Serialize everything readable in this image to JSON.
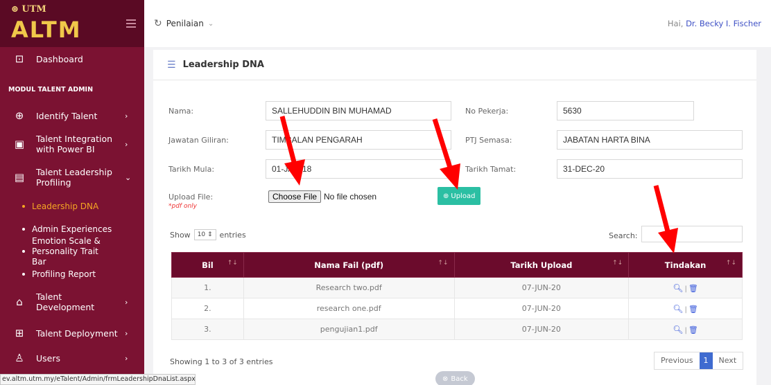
{
  "brand": {
    "utm": "UTM",
    "altm": "ALTM"
  },
  "sidebar": {
    "dashboard": "Dashboard",
    "section_title": "MODUL TALENT ADMIN",
    "items": [
      {
        "label": "Identify Talent"
      },
      {
        "label": "Talent Integration with Power BI"
      },
      {
        "label": "Talent Leadership Profiling"
      },
      {
        "label": "Talent Development"
      },
      {
        "label": "Talent Deployment"
      },
      {
        "label": "Users"
      }
    ],
    "sub_items": [
      {
        "label": "Leadership DNA"
      },
      {
        "label": "Admin Experiences"
      },
      {
        "label": "Emotion Scale & Personality Trait Bar"
      },
      {
        "label": "Profiling Report"
      }
    ]
  },
  "status_url": "ev.altm.utm.my/eTalent/Admin/frmLeadershipDnaList.aspx",
  "topbar": {
    "menu": "Penilaian",
    "greeting": "Hai,",
    "user": "Dr. Becky I. Fischer"
  },
  "card": {
    "title": "Leadership DNA"
  },
  "form": {
    "nama_label": "Nama:",
    "nama_value": "SALLEHUDDIN BIN MUHAMAD",
    "no_pekerja_label": "No Pekerja:",
    "no_pekerja_value": "5630",
    "jawatan_label": "Jawatan Giliran:",
    "jawatan_value": "TIMBALAN PENGARAH",
    "ptj_label": "PTJ Semasa:",
    "ptj_value": "JABATAN HARTA BINA",
    "tarikh_mula_label": "Tarikh Mula:",
    "tarikh_mula_value": "01-JAN-18",
    "tarikh_tamat_label": "Tarikh Tamat:",
    "tarikh_tamat_value": "31-DEC-20",
    "upload_label": "Upload File:",
    "upload_note": "*pdf only",
    "choose_file": "Choose File",
    "no_file": "No file chosen",
    "upload_button": "Upload"
  },
  "table_controls": {
    "show": "Show",
    "entries_value": "10",
    "entries": "entries",
    "search_label": "Search:"
  },
  "table": {
    "headers": [
      "Bil",
      "Nama Fail (pdf)",
      "Tarikh Upload",
      "Tindakan"
    ],
    "rows": [
      {
        "bil": "1.",
        "file": "Research two.pdf",
        "date": "07-JUN-20"
      },
      {
        "bil": "2.",
        "file": "research one.pdf",
        "date": "07-JUN-20"
      },
      {
        "bil": "3.",
        "file": "pengujian1.pdf",
        "date": "07-JUN-20"
      }
    ]
  },
  "footer": {
    "showing": "Showing 1 to 3 of 3 entries",
    "previous": "Previous",
    "page": "1",
    "next": "Next",
    "back": "Back"
  },
  "colors": {
    "sidebar": "#7b1232",
    "table_header": "#6b0b2c",
    "upload_button": "#2bbfa3",
    "active_link": "#f5a623",
    "annotation_arrow": "#ff0000"
  }
}
